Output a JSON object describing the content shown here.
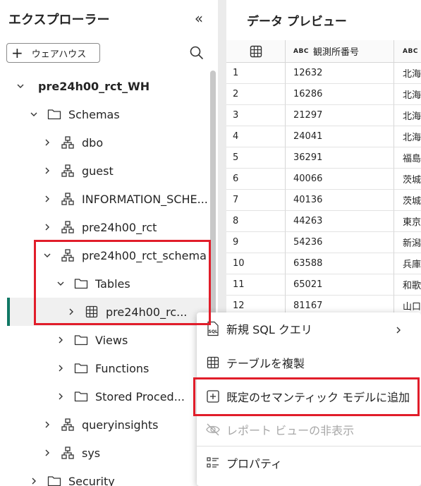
{
  "explorer": {
    "title": "エクスプローラー",
    "collapse_glyph": "«",
    "add_warehouse_label": "ウェアハウス",
    "tree": [
      {
        "label": "pre24h00_rct_WH",
        "indent": 0,
        "chevron": "down",
        "icon": "none",
        "bold": true
      },
      {
        "label": "Schemas",
        "indent": 1,
        "chevron": "down",
        "icon": "folder"
      },
      {
        "label": "dbo",
        "indent": 2,
        "chevron": "right",
        "icon": "schema"
      },
      {
        "label": "guest",
        "indent": 2,
        "chevron": "right",
        "icon": "schema"
      },
      {
        "label": "INFORMATION_SCHE...",
        "indent": 2,
        "chevron": "right",
        "icon": "schema"
      },
      {
        "label": "pre24h00_rct",
        "indent": 2,
        "chevron": "right",
        "icon": "schema"
      },
      {
        "label": "pre24h00_rct_schema",
        "indent": 2,
        "chevron": "down",
        "icon": "schema"
      },
      {
        "label": "Tables",
        "indent": 3,
        "chevron": "down",
        "icon": "folder"
      },
      {
        "label": "pre24h00_rc...",
        "indent": 4,
        "chevron": "right",
        "icon": "table",
        "selected": true
      },
      {
        "label": "Views",
        "indent": 3,
        "chevron": "right",
        "icon": "folder"
      },
      {
        "label": "Functions",
        "indent": 3,
        "chevron": "right",
        "icon": "folder"
      },
      {
        "label": "Stored Proced...",
        "indent": 3,
        "chevron": "right",
        "icon": "folder"
      },
      {
        "label": "queryinsights",
        "indent": 2,
        "chevron": "right",
        "icon": "schema"
      },
      {
        "label": "sys",
        "indent": 2,
        "chevron": "right",
        "icon": "schema"
      },
      {
        "label": "Security",
        "indent": 1,
        "chevron": "right",
        "icon": "folder"
      }
    ]
  },
  "preview": {
    "title": "データ プレビュー",
    "type_tag": "ABC",
    "columns": [
      "観測所番号",
      ""
    ],
    "rows": [
      {
        "idx": "1",
        "a": "12632",
        "b": "北海"
      },
      {
        "idx": "2",
        "a": "16286",
        "b": "北海"
      },
      {
        "idx": "3",
        "a": "21297",
        "b": "北海"
      },
      {
        "idx": "4",
        "a": "24041",
        "b": "北海"
      },
      {
        "idx": "5",
        "a": "36291",
        "b": "福島"
      },
      {
        "idx": "6",
        "a": "40066",
        "b": "茨城"
      },
      {
        "idx": "7",
        "a": "40136",
        "b": "茨城"
      },
      {
        "idx": "8",
        "a": "44263",
        "b": "東京"
      },
      {
        "idx": "9",
        "a": "54236",
        "b": "新潟"
      },
      {
        "idx": "10",
        "a": "63588",
        "b": "兵庫"
      },
      {
        "idx": "11",
        "a": "65021",
        "b": "和歌"
      },
      {
        "idx": "12",
        "a": "81167",
        "b": "山口"
      }
    ]
  },
  "context_menu": {
    "items": [
      {
        "label": "新規 SQL クエリ",
        "icon": "sql",
        "disabled": false,
        "submenu": true
      },
      {
        "label": "テーブルを複製",
        "icon": "table",
        "disabled": false
      },
      {
        "label": "既定のセマンティック モデルに追加",
        "icon": "add-box",
        "disabled": false
      },
      {
        "label": "レポート ビューの非表示",
        "icon": "eye-off",
        "disabled": true
      },
      {
        "label": "プロパティ",
        "icon": "properties",
        "disabled": false
      }
    ]
  },
  "colors": {
    "highlight": "#e11d2a",
    "accent": "#117865",
    "disabled": "#a8a8a8"
  }
}
